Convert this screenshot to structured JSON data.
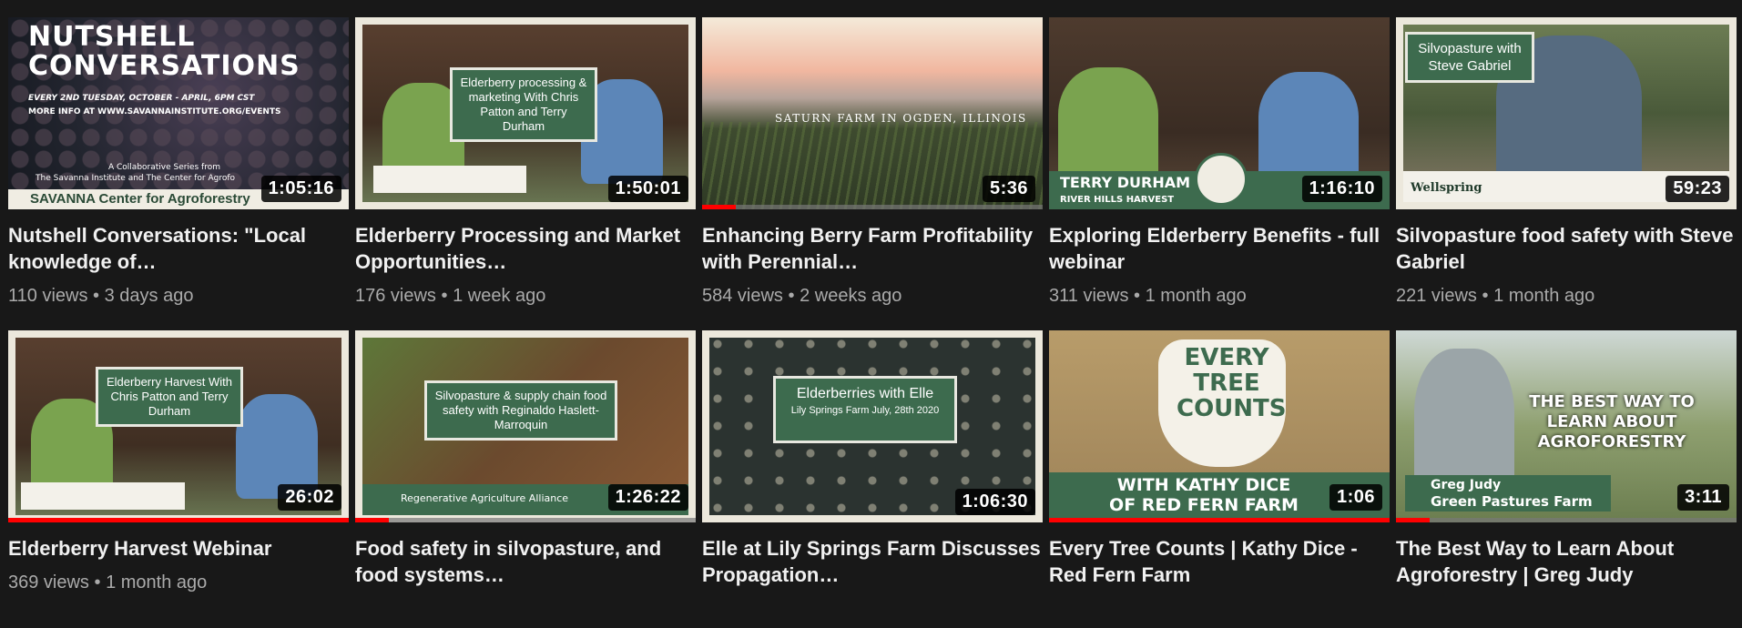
{
  "videos": [
    {
      "title": "Nutshell Conversations: \"Local knowledge of…",
      "views": "110 views",
      "age": "3 days ago",
      "duration": "1:05:16",
      "thumb_text": {
        "heading": "NUTSHELL CONVERSATIONS",
        "line1": "EVERY 2ND TUESDAY, OCTOBER - APRIL, 6PM CST",
        "line2": "MORE INFO AT WWW.SAVANNAINSTITUTE.ORG/EVENTS",
        "line3": "A Collaborative Series from",
        "line4": "The Savanna Institute and The Center for Agrofo",
        "footer": "SAVANNA    Center for Agroforestry"
      }
    },
    {
      "title": "Elderberry Processing and Market Opportunities…",
      "views": "176 views",
      "age": "1 week ago",
      "duration": "1:50:01",
      "thumb_text": {
        "sign": "Elderberry processing & marketing With Chris Patton and Terry Durham"
      }
    },
    {
      "title": "Enhancing Berry Farm Profitability with Perennial…",
      "views": "584 views",
      "age": "2 weeks ago",
      "duration": "5:36",
      "progress": 0.1,
      "thumb_text": {
        "caption": "SATURN FARM IN OGDEN, ILLINOIS"
      }
    },
    {
      "title": "Exploring Elderberry Benefits - full webinar",
      "views": "311 views",
      "age": "1 month ago",
      "duration": "1:16:10",
      "thumb_text": {
        "name": "TERRY DURHAM",
        "sub": "RIVER HILLS HARVEST"
      }
    },
    {
      "title": "Silvopasture food safety with Steve Gabriel",
      "views": "221 views",
      "age": "1 month ago",
      "duration": "59:23",
      "thumb_text": {
        "sign": "Silvopasture with Steve Gabriel",
        "footer": "Wellspring"
      }
    },
    {
      "title": "Elderberry Harvest Webinar",
      "views": "369 views",
      "age": "1 month ago",
      "duration": "26:02",
      "progress": 1.0,
      "thumb_text": {
        "sign": "Elderberry Harvest With Chris Patton and Terry Durham"
      }
    },
    {
      "title": "Food safety in silvopasture, and food systems…",
      "views": "",
      "age": "",
      "duration": "1:26:22",
      "progress": 0.1,
      "thumb_text": {
        "sign": "Silvopasture & supply chain food safety with Reginaldo Haslett-Marroquin",
        "footer": "Regenerative Agriculture Alliance"
      }
    },
    {
      "title": "Elle at Lily Springs Farm Discusses Propagation…",
      "views": "",
      "age": "",
      "duration": "1:06:30",
      "thumb_text": {
        "sign": "Elderberries with Elle",
        "sub": "Lily Springs Farm July, 28th 2020"
      }
    },
    {
      "title": "Every Tree Counts | Kathy Dice - Red Fern Farm",
      "views": "",
      "age": "",
      "duration": "1:06",
      "progress": 1.0,
      "thumb_text": {
        "big": "EVERY TREE COUNTS",
        "banner": "WITH KATHY DICE OF RED FERN FARM"
      }
    },
    {
      "title": "The Best Way to Learn About Agroforestry | Greg Judy",
      "views": "",
      "age": "",
      "duration": "3:11",
      "progress": 0.1,
      "thumb_text": {
        "big": "THE BEST WAY TO LEARN ABOUT AGROFORESTRY",
        "name": "Greg Judy",
        "sub": "Green Pastures Farm"
      }
    }
  ],
  "separator": "•"
}
